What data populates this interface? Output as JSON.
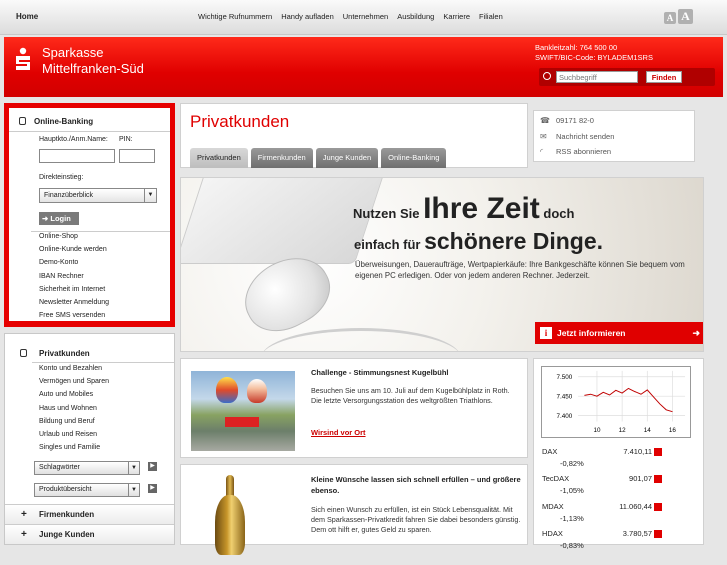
{
  "topnav": {
    "home": "Home",
    "links": [
      "Wichtige Rufnummern",
      "Handy aufladen",
      "Unternehmen",
      "Ausbildung",
      "Karriere",
      "Filialen"
    ],
    "font_small": "A",
    "font_large": "A"
  },
  "header": {
    "logo_mark": "ᵴ",
    "bank_line1": "Sparkasse",
    "bank_line2": "Mittelfranken-Süd",
    "blz": "Bankleitzahl: 764 500 00",
    "swift": "SWIFT/BIC-Code: BYLADEM1SRS",
    "search_placeholder": "Suchbegriff",
    "search_button": "Finden"
  },
  "online_banking": {
    "title": "Online-Banking",
    "account_label": "Hauptkto./Anm.Name:",
    "pin_label": "PIN:",
    "entry_label": "Direkteinstieg:",
    "entry_selected": "Finanzüberblick",
    "login": "Login",
    "links": [
      "Online-Shop",
      "Online-Kunde werden",
      "Demo-Konto",
      "IBAN Rechner",
      "Sicherheit im Internet",
      "Newsletter Anmeldung",
      "Free SMS versenden"
    ]
  },
  "privatkunden_nav": {
    "title": "Privatkunden",
    "links": [
      "Konto und Bezahlen",
      "Vermögen und Sparen",
      "Auto und Mobiles",
      "Haus und Wohnen",
      "Bildung und Beruf",
      "Urlaub und Reisen",
      "Singles und Familie"
    ],
    "select1": "Schlagwörter",
    "select2": "Produktübersicht",
    "sub1": "Firmenkunden",
    "sub2": "Junge Kunden"
  },
  "main": {
    "title": "Privatkunden",
    "tabs": [
      "Privatkunden",
      "Firmenkunden",
      "Junge Kunden",
      "Online-Banking"
    ]
  },
  "contact": {
    "phone": "09171 82-0",
    "message": "Nachricht senden",
    "rss": "RSS abonnieren"
  },
  "hero": {
    "line1_small": "Nutzen Sie",
    "line1_big": "Ihre Zeit",
    "line1_end": "doch",
    "line2_small": "einfach für",
    "line2_big": "schönere Dinge.",
    "description": "Überweisungen, Daueraufträge, Wertpapierkäufe: Ihre Bankgeschäfte können Sie bequem vom eigenen PC erledigen. Oder von jedem anderen Rechner. Jederzeit.",
    "cta": "Jetzt informieren"
  },
  "news": [
    {
      "title": "Challenge - Stimmungsnest Kugelbühl",
      "text": "Besuchen Sie uns am 10. Juli auf dem Kugelbühlplatz in Roth. Die letzte Versorgungsstation des weltgrößten Triathlons.",
      "link": "Wirsind vor Ort"
    },
    {
      "title": "Kleine Wünsche lassen sich schnell erfüllen – und größere ebenso.",
      "text": "Sich einen Wunsch zu erfüllen, ist ein Stück Lebensqualität. Mit dem Sparkassen-Privatkredit fahren Sie dabei besonders günstig. Dem ott hilft er, gutes Geld zu sparen."
    }
  ],
  "chart_data": {
    "type": "line",
    "x": [
      9,
      9.5,
      10,
      10.5,
      11,
      11.5,
      12,
      12.5,
      13,
      13.5,
      14,
      14.5,
      15,
      15.5,
      16
    ],
    "y": [
      7452,
      7455,
      7450,
      7460,
      7453,
      7465,
      7458,
      7470,
      7462,
      7455,
      7466,
      7448,
      7430,
      7415,
      7410
    ],
    "xticks": [
      "10",
      "12",
      "14",
      "16"
    ],
    "yticks": [
      "7.500",
      "7.450",
      "7.400"
    ],
    "ylim": [
      7385,
      7515
    ],
    "xlim": [
      8.5,
      17
    ]
  },
  "stocks": [
    {
      "name": "DAX",
      "value": "7.410,11",
      "change": "-0,82%"
    },
    {
      "name": "TecDAX",
      "value": "901,07",
      "change": "-1,05%"
    },
    {
      "name": "MDAX",
      "value": "11.060,44",
      "change": "-1,13%"
    },
    {
      "name": "HDAX",
      "value": "3.780,57",
      "change": "-0,83%"
    }
  ],
  "colors": {
    "brand": "#e00000",
    "dark_red": "#b00000"
  }
}
